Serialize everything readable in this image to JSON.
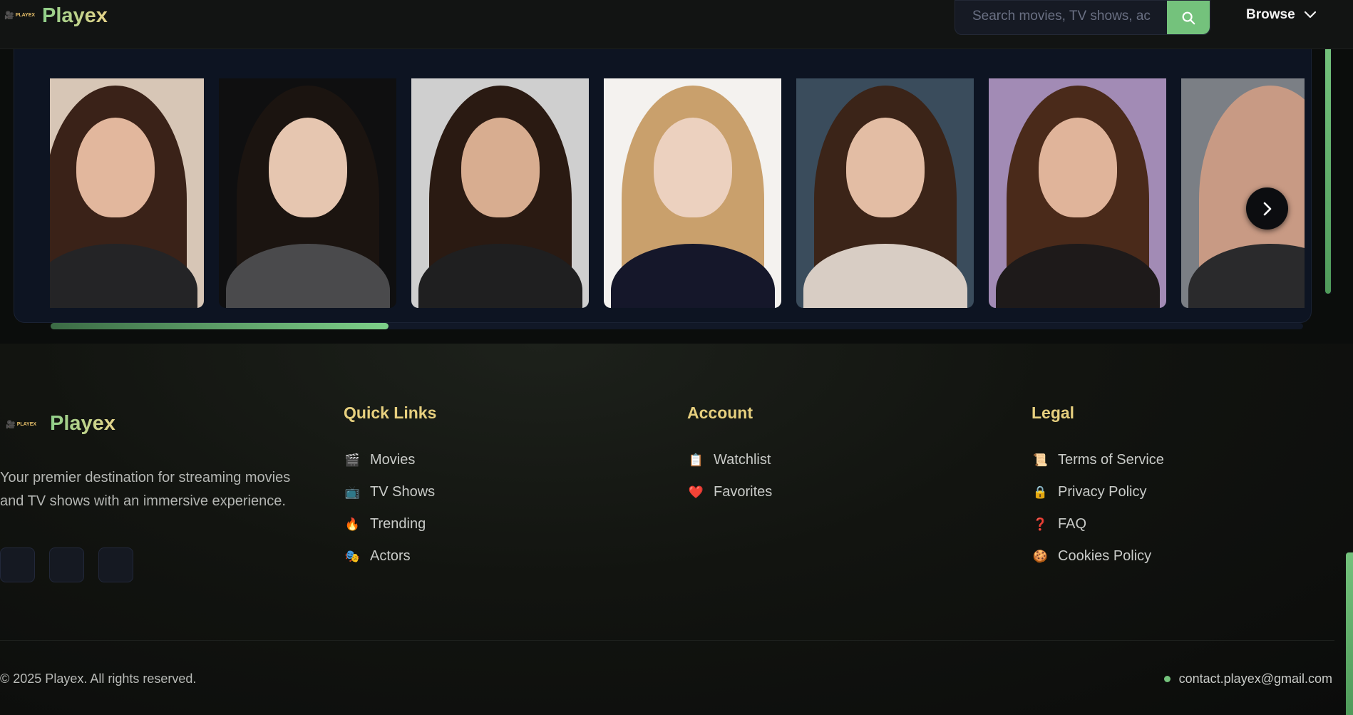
{
  "header": {
    "logo_text": "PLAYEX",
    "brand": "Playex",
    "search_placeholder": "Search movies, TV shows, ac",
    "browse_label": "Browse"
  },
  "carousel": {
    "progress": 0.27,
    "cards": [
      {
        "skin": "#e2b79d",
        "hair": "#3a2218",
        "bg": "#d7c6b6",
        "body": "#242426"
      },
      {
        "skin": "#e6c6b0",
        "hair": "#1b1410",
        "bg": "#0f0f10",
        "body": "#4a4a4c"
      },
      {
        "skin": "#d8ad90",
        "hair": "#2a1a12",
        "bg": "#cfcfcf",
        "body": "#1f1f20"
      },
      {
        "skin": "#ecd1bf",
        "hair": "#c9a06c",
        "bg": "#f4f2ef",
        "body": "#15172a"
      },
      {
        "skin": "#e3bda4",
        "hair": "#3b2418",
        "bg": "#3a4c5c",
        "body": "#d8cdc4"
      },
      {
        "skin": "#e0b49a",
        "hair": "#4a2a1a",
        "bg": "#a28bb5",
        "body": "#1e1a1a"
      },
      {
        "skin": "#c89a84",
        "hair": "#c89a84",
        "bg": "#7b7f85",
        "body": "#2a2a2c"
      }
    ]
  },
  "footer": {
    "logo_text": "PLAYEX",
    "brand": "Playex",
    "description": "Your premier destination for streaming movies and TV shows with an immersive experience.",
    "columns": [
      {
        "title": "Quick Links",
        "items": [
          {
            "icon": "🎬",
            "icon_name": "clapper-icon",
            "label": "Movies"
          },
          {
            "icon": "📺",
            "icon_name": "tv-icon",
            "label": "TV Shows"
          },
          {
            "icon": "🔥",
            "icon_name": "fire-icon",
            "label": "Trending"
          },
          {
            "icon": "🎭",
            "icon_name": "theater-masks-icon",
            "label": "Actors"
          }
        ]
      },
      {
        "title": "Account",
        "items": [
          {
            "icon": "📋",
            "icon_name": "clipboard-icon",
            "label": "Watchlist"
          },
          {
            "icon": "❤️",
            "icon_name": "heart-icon",
            "label": "Favorites"
          }
        ]
      },
      {
        "title": "Legal",
        "items": [
          {
            "icon": "📜",
            "icon_name": "scroll-icon",
            "label": "Terms of Service"
          },
          {
            "icon": "🔒",
            "icon_name": "lock-icon",
            "label": "Privacy Policy"
          },
          {
            "icon": "❓",
            "icon_name": "question-icon",
            "label": "FAQ"
          },
          {
            "icon": "🍪",
            "icon_name": "cookie-icon",
            "label": "Cookies Policy"
          }
        ]
      }
    ],
    "copyright": "© 2025 Playex. All rights reserved.",
    "contact": "contact.playex@gmail.com"
  }
}
